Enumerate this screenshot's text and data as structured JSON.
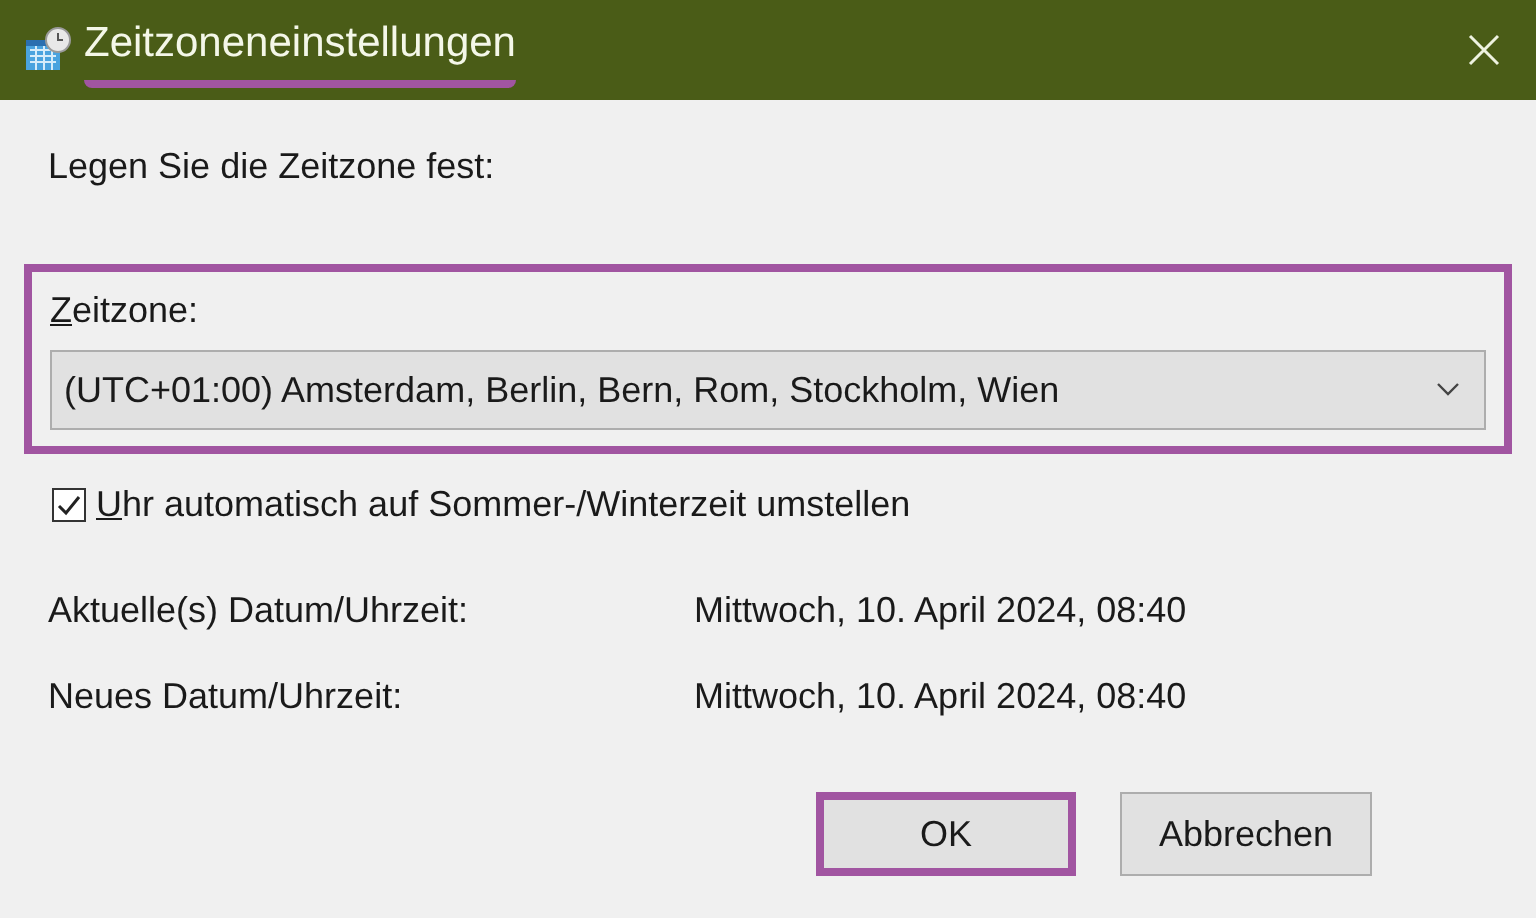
{
  "window": {
    "title": "Zeitzoneneinstellungen",
    "title_highlighted": true
  },
  "prompt": "Legen Sie die Zeitzone fest:",
  "timezone": {
    "label": "Zeitzone:",
    "value": "(UTC+01:00) Amsterdam, Berlin, Bern, Rom, Stockholm, Wien",
    "highlighted": true
  },
  "dst_checkbox": {
    "label": "Uhr automatisch auf Sommer-/Winterzeit umstellen",
    "checked": true
  },
  "info_rows": [
    {
      "label": "Aktuelle(s) Datum/Uhrzeit:",
      "value": "Mittwoch, 10. April 2024, 08:40"
    },
    {
      "label": "Neues Datum/Uhrzeit:",
      "value": "Mittwoch, 10. April 2024, 08:40"
    }
  ],
  "buttons": [
    {
      "label": "OK",
      "highlighted": true
    },
    {
      "label": "Abbrechen",
      "highlighted": false
    }
  ]
}
